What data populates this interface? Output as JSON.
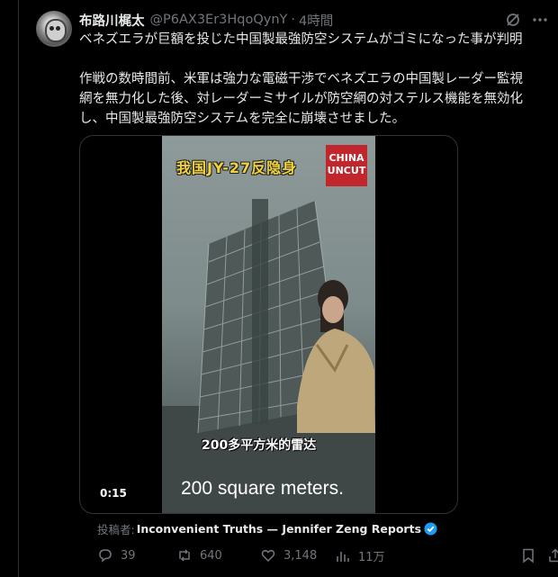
{
  "tweet": {
    "name": "布路川梶太",
    "handle": "@P6AX3Er3HqoQynY",
    "separator": "·",
    "time": "4時間",
    "paragraph1": "ベネズエラが巨額を投じた中国製最強防空システムがゴミになった事が判明",
    "paragraph2": "作戦の数時間前、米軍は強力な電磁干渉でベネズエラの中国製レーダー監視\n網を無力化した後、対レーダーミサイルが防空網の対ステルス機能を無効化\nし、中国製最強防空システムを完全に崩壊させました。"
  },
  "video": {
    "banner": "我国JY-27反隐身",
    "logo": "CHINA\nUNCUT",
    "chinese_caption": "200多平方米的雷达",
    "subtitle": "200 square meters.",
    "timestamp": "0:15"
  },
  "attribution": {
    "label": "投稿者:",
    "author": "Inconvenient Truths — Jennifer Zeng Reports"
  },
  "actions": {
    "replies": "39",
    "reposts": "640",
    "likes": "3,148",
    "views": "11万"
  },
  "colors": {
    "background": "#000000",
    "text": "#e7e9ea",
    "secondary": "#71767b",
    "verified": "#1d9bf0",
    "logo_red": "#c1262d"
  },
  "icons": [
    "grok-icon",
    "more-icon",
    "verified-icon",
    "reply-icon",
    "repost-icon",
    "like-icon",
    "views-icon",
    "bookmark-icon",
    "share-icon"
  ]
}
